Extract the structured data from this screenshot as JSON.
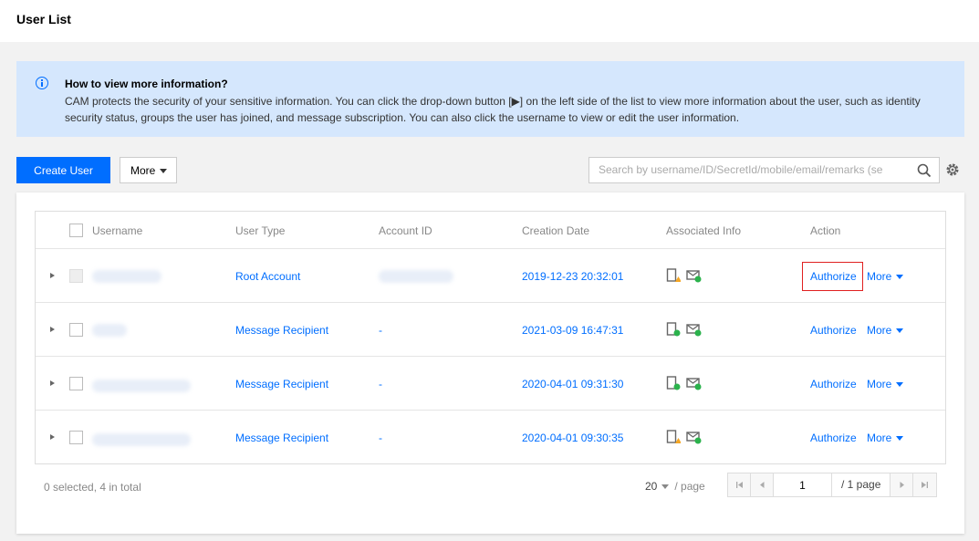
{
  "header": {
    "title": "User List"
  },
  "notice": {
    "title": "How to view more information?",
    "body": "CAM protects the security of your sensitive information. You can click the drop-down button [▶] on the left side of the list to view more information about the user, such as identity security status, groups the user has joined, and message subscription. You can also click the username to view or edit the user information."
  },
  "toolbar": {
    "create_label": "Create User",
    "more_label": "More",
    "search_placeholder": "Search by username/ID/SecretId/mobile/email/remarks (se"
  },
  "table": {
    "columns": [
      "Username",
      "User Type",
      "Account ID",
      "Creation Date",
      "Associated Info",
      "Action"
    ],
    "rows": [
      {
        "type": "Root Account",
        "account_id": "",
        "date": "2019-12-23 20:32:01",
        "phone_status": "warning",
        "mail_status": "ok",
        "action": "Authorize",
        "more": "More"
      },
      {
        "type": "Message Recipient",
        "account_id": "-",
        "date": "2021-03-09 16:47:31",
        "phone_status": "ok",
        "mail_status": "ok",
        "action": "Authorize",
        "more": "More"
      },
      {
        "type": "Message Recipient",
        "account_id": "-",
        "date": "2020-04-01 09:31:30",
        "phone_status": "ok",
        "mail_status": "ok",
        "action": "Authorize",
        "more": "More"
      },
      {
        "type": "Message Recipient",
        "account_id": "-",
        "date": "2020-04-01 09:30:35",
        "phone_status": "warning",
        "mail_status": "ok",
        "action": "Authorize",
        "more": "More"
      }
    ]
  },
  "footer": {
    "selection": "0 selected, 4 in total",
    "page_size": "20",
    "per_page": "/ page",
    "current_page": "1",
    "total_pages": "/ 1 page"
  },
  "colors": {
    "accent": "#006eff",
    "warning": "#f5a623",
    "ok": "#2bb24c",
    "highlight": "#e02020"
  }
}
